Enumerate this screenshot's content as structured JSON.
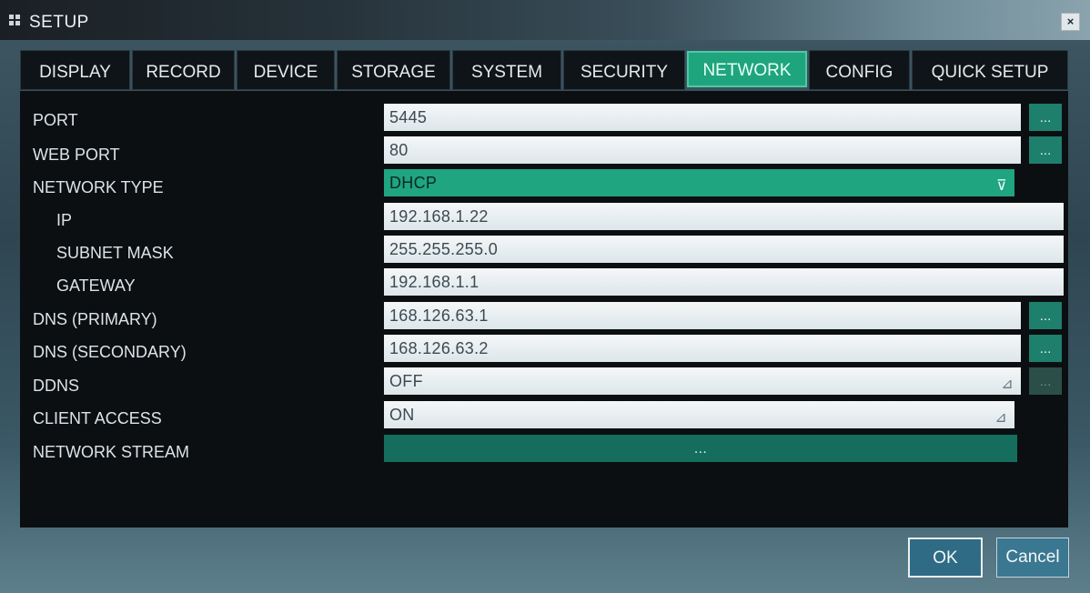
{
  "window": {
    "title": "SETUP",
    "close_label": "×"
  },
  "tabs": [
    {
      "label": "DISPLAY"
    },
    {
      "label": "RECORD"
    },
    {
      "label": "DEVICE"
    },
    {
      "label": "STORAGE"
    },
    {
      "label": "SYSTEM"
    },
    {
      "label": "SECURITY"
    },
    {
      "label": "NETWORK",
      "active": true
    },
    {
      "label": "CONFIG"
    },
    {
      "label": "QUICK SETUP"
    }
  ],
  "fields": {
    "port": {
      "label": "PORT",
      "value": "5445",
      "button": "..."
    },
    "web_port": {
      "label": "WEB PORT",
      "value": "80",
      "button": "..."
    },
    "network_type": {
      "label": "NETWORK TYPE",
      "value": "DHCP",
      "arrow": "⊽"
    },
    "ip": {
      "label": "IP",
      "value": "192.168.1.22"
    },
    "subnet_mask": {
      "label": "SUBNET MASK",
      "value": "255.255.255.0"
    },
    "gateway": {
      "label": "GATEWAY",
      "value": "192.168.1.1"
    },
    "dns_primary": {
      "label": "DNS (PRIMARY)",
      "value": "168.126.63.1",
      "button": "..."
    },
    "dns_secondary": {
      "label": "DNS (SECONDARY)",
      "value": "168.126.63.2",
      "button": "..."
    },
    "ddns": {
      "label": "DDNS",
      "value": "OFF",
      "arrow": "⊿",
      "button": "..."
    },
    "client_access": {
      "label": "CLIENT ACCESS",
      "value": "ON",
      "arrow": "⊿"
    },
    "network_stream": {
      "label": "NETWORK STREAM",
      "button": "..."
    }
  },
  "footer": {
    "ok_label": "OK",
    "cancel_label": "Cancel"
  },
  "colors": {
    "accent": "#1ea57e",
    "panel_bg": "#0b0f12",
    "field_bg": "#eef3f5"
  }
}
